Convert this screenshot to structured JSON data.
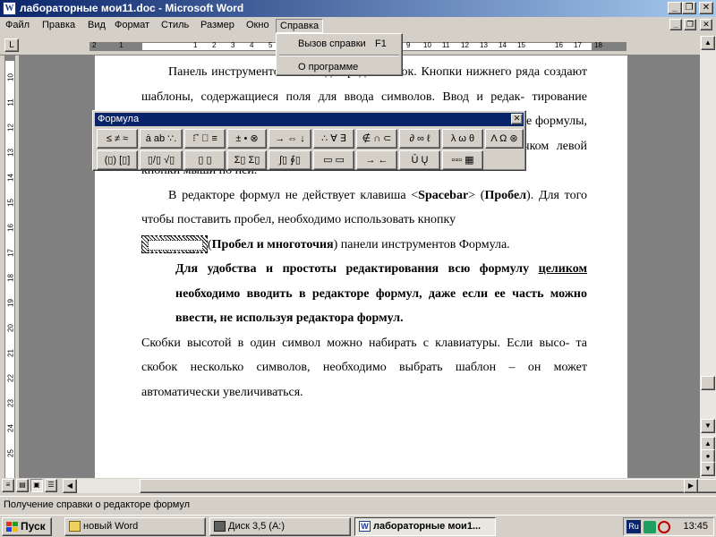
{
  "window": {
    "title": "лабораторные мои11.doc - Microsoft Word",
    "app_icon": "W",
    "controls": [
      "minimize-icon",
      "restore-icon",
      "close-icon"
    ]
  },
  "menu": {
    "items": [
      "Файл",
      "Правка",
      "Вид",
      "Формат",
      "Стиль",
      "Размер",
      "Окно",
      "Справка"
    ],
    "active": "Справка"
  },
  "help_menu": {
    "items": [
      {
        "label": "Вызов справки",
        "shortcut": "F1"
      },
      {
        "label": "О программе",
        "shortcut": ""
      }
    ]
  },
  "ruler": {
    "h_numbers": [
      "2",
      "1",
      "1",
      "2",
      "3",
      "4",
      "5",
      "6",
      "7",
      "8",
      "9",
      "10",
      "11",
      "12",
      "13",
      "14",
      "15",
      "16",
      "17",
      "18"
    ],
    "v_numbers": [
      "10",
      "11",
      "12",
      "13",
      "14",
      "15",
      "16",
      "17",
      "18",
      "19",
      "20",
      "21",
      "22",
      "23",
      "24",
      "25"
    ]
  },
  "formula_toolbar": {
    "title": "Формула",
    "row1": [
      "≤ ≠ ≈",
      "ȧ ab ∵.",
      "⁝ ⃗ ⃞ ≡",
      "± • ⊗",
      "→ ⇔ ↓",
      "∴ ∀ ∃",
      "∉ ∩ ⊂",
      "∂ ∞ ℓ",
      "λ ω θ",
      "Λ Ω ⊛"
    ],
    "row2": [
      "(▯) [▯]",
      "▯/▯ √▯",
      "▯ ▯",
      "Σ▯ Σ▯",
      "∫▯ ∮▯",
      "▭ ▭",
      "→ ←",
      "Ū Ų",
      "▫▫▫ ▦"
    ]
  },
  "document": {
    "p1": "Панель инструментов имеет два ряда кнопок. Кнопки нижнего ряда создают шаблоны, содержащиеся поля для ввода символов. Ввод и редак- тирование формулы завершается нажатием клавиши <Esc> или щелчком мыши вне формулы, в любой другой области. Открыть формулу можно двойным щелчком левой кнопки мыши по ней.",
    "p2_a": "В редакторе формул не действует клавиша <",
    "p2_key": "Spacebar",
    "p2_b": "> (",
    "p2_key2": "Пробел",
    "p2_c": "). Для того чтобы поставить пробел, необходимо использовать кнопку",
    "p2_d": "(",
    "p2_bold": "Пробел и многоточия",
    "p2_e": ") панели инструментов Формула.",
    "p3_a": "Для удобства и простоты редактирования всю формулу ",
    "p3_u": "целиком",
    "p3_b": " необходимо вводить в редакторе формул, даже если ее часть можно ввести, не используя редактора формул.",
    "p4": "Скобки высотой в один символ можно набирать с клавиатуры. Если высо- та скобок несколько символов, необходимо выбрать шаблон – он может автоматически увеличиваться."
  },
  "status": {
    "text": "Получение справки о редакторе формул"
  },
  "taskbar": {
    "start": "Пуск",
    "tasks": [
      {
        "label": "новый Word",
        "icon": "folder-icon",
        "active": false
      },
      {
        "label": "Диск 3,5 (A:)",
        "icon": "floppy-icon",
        "active": false
      },
      {
        "label": "лабораторные мои1...",
        "icon": "word-icon",
        "active": true
      }
    ],
    "lang": "Ru",
    "clock": "13:45"
  },
  "colors": {
    "titlebar_start": "#0a246a",
    "titlebar_end": "#a6caf0",
    "face": "#d4d0c8",
    "workspace": "#808080"
  }
}
